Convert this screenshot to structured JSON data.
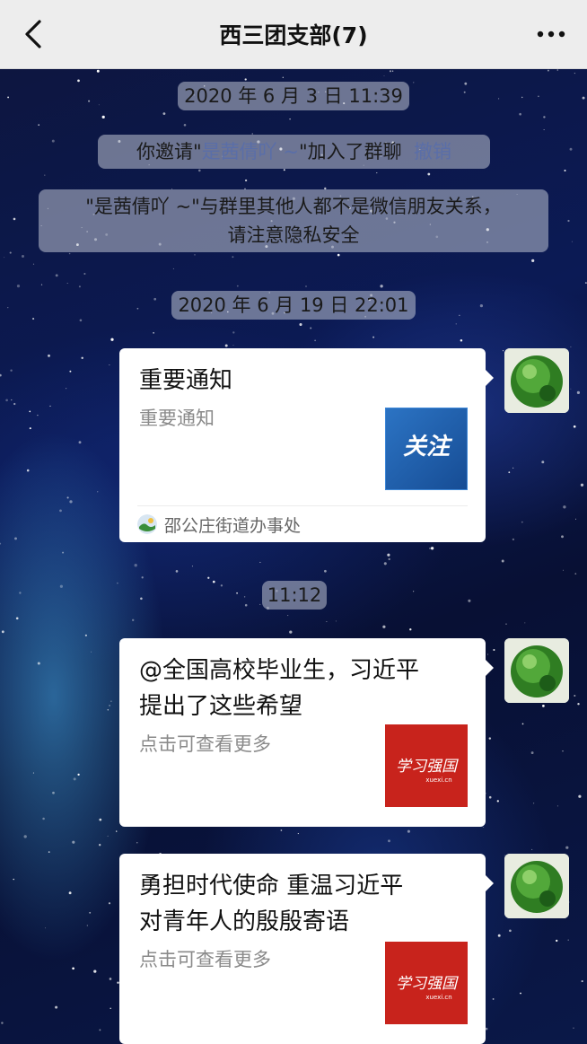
{
  "header": {
    "title": "西三团支部(7)"
  },
  "timestamps": [
    "2020 年 6 月 3 日 11:39",
    "2020 年 6 月 19 日 22:01",
    "11:12"
  ],
  "system_messages": {
    "invite": {
      "prefix": "你邀请\"",
      "name": "是茜倩吖 ~",
      "suffix": "\"加入了群聊",
      "action": "撤销"
    },
    "privacy": {
      "line1": "\"是茜倩吖 ~\"与群里其他人都不是微信朋友关系，",
      "line2": "请注意隐私安全"
    }
  },
  "messages": [
    {
      "title": "重要通知",
      "desc": "重要通知",
      "thumb_label": "关注",
      "source": "邵公庄街道办事处"
    },
    {
      "title_line1": "@全国高校毕业生，习近平",
      "title_line2": "提出了这些希望",
      "desc": "点击可查看更多",
      "thumb_label": "学习强国",
      "thumb_sub": "xuexi.cn"
    },
    {
      "title_line1": "勇担时代使命 重温习近平",
      "title_line2": "对青年人的殷殷寄语",
      "desc": "点击可查看更多",
      "thumb_label": "学习强国",
      "thumb_sub": "xuexi.cn"
    }
  ],
  "colors": {
    "navbar_bg": "#ededed",
    "link_blue": "#5a6ea8",
    "xuexi_red": "#c8231c",
    "guanzhu_blue": "#1f5fae"
  },
  "icons": {
    "back": "chevron-left-icon",
    "more": "more-dots-icon",
    "avatar": "green-globe-avatar"
  }
}
